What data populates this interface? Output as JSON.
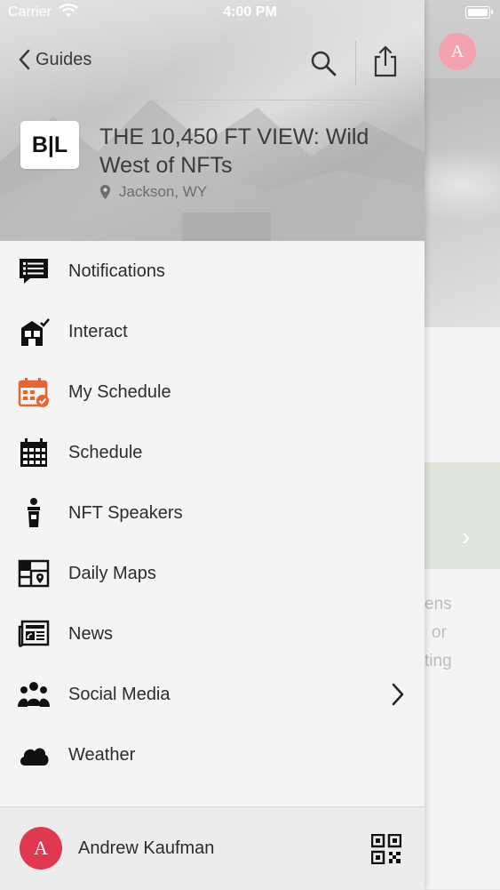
{
  "status_bar": {
    "carrier": "Carrier",
    "time": "4:00 PM"
  },
  "nav": {
    "back_label": "Guides"
  },
  "event": {
    "logo_text": "B|L",
    "title": "THE 10,450 FT VIEW: Wild West of NFTs",
    "location": "Jackson, WY"
  },
  "menu": {
    "items": [
      {
        "label": "Notifications",
        "icon": "notifications-icon"
      },
      {
        "label": "Interact",
        "icon": "interact-icon"
      },
      {
        "label": "My Schedule",
        "icon": "my-schedule-icon",
        "accent": "#e8642c"
      },
      {
        "label": "Schedule",
        "icon": "calendar-icon"
      },
      {
        "label": "NFT Speakers",
        "icon": "podium-icon"
      },
      {
        "label": "Daily Maps",
        "icon": "map-icon"
      },
      {
        "label": "News",
        "icon": "news-icon"
      },
      {
        "label": "Social Media",
        "icon": "people-icon",
        "has_chevron": true
      },
      {
        "label": "Weather",
        "icon": "cloud-icon"
      }
    ]
  },
  "user": {
    "initial": "A",
    "name": "Andrew Kaufman",
    "avatar_color": "#e0394f"
  },
  "background": {
    "avatar_initial": "A",
    "peek_text": [
      "ens",
      "or",
      "ting"
    ]
  }
}
